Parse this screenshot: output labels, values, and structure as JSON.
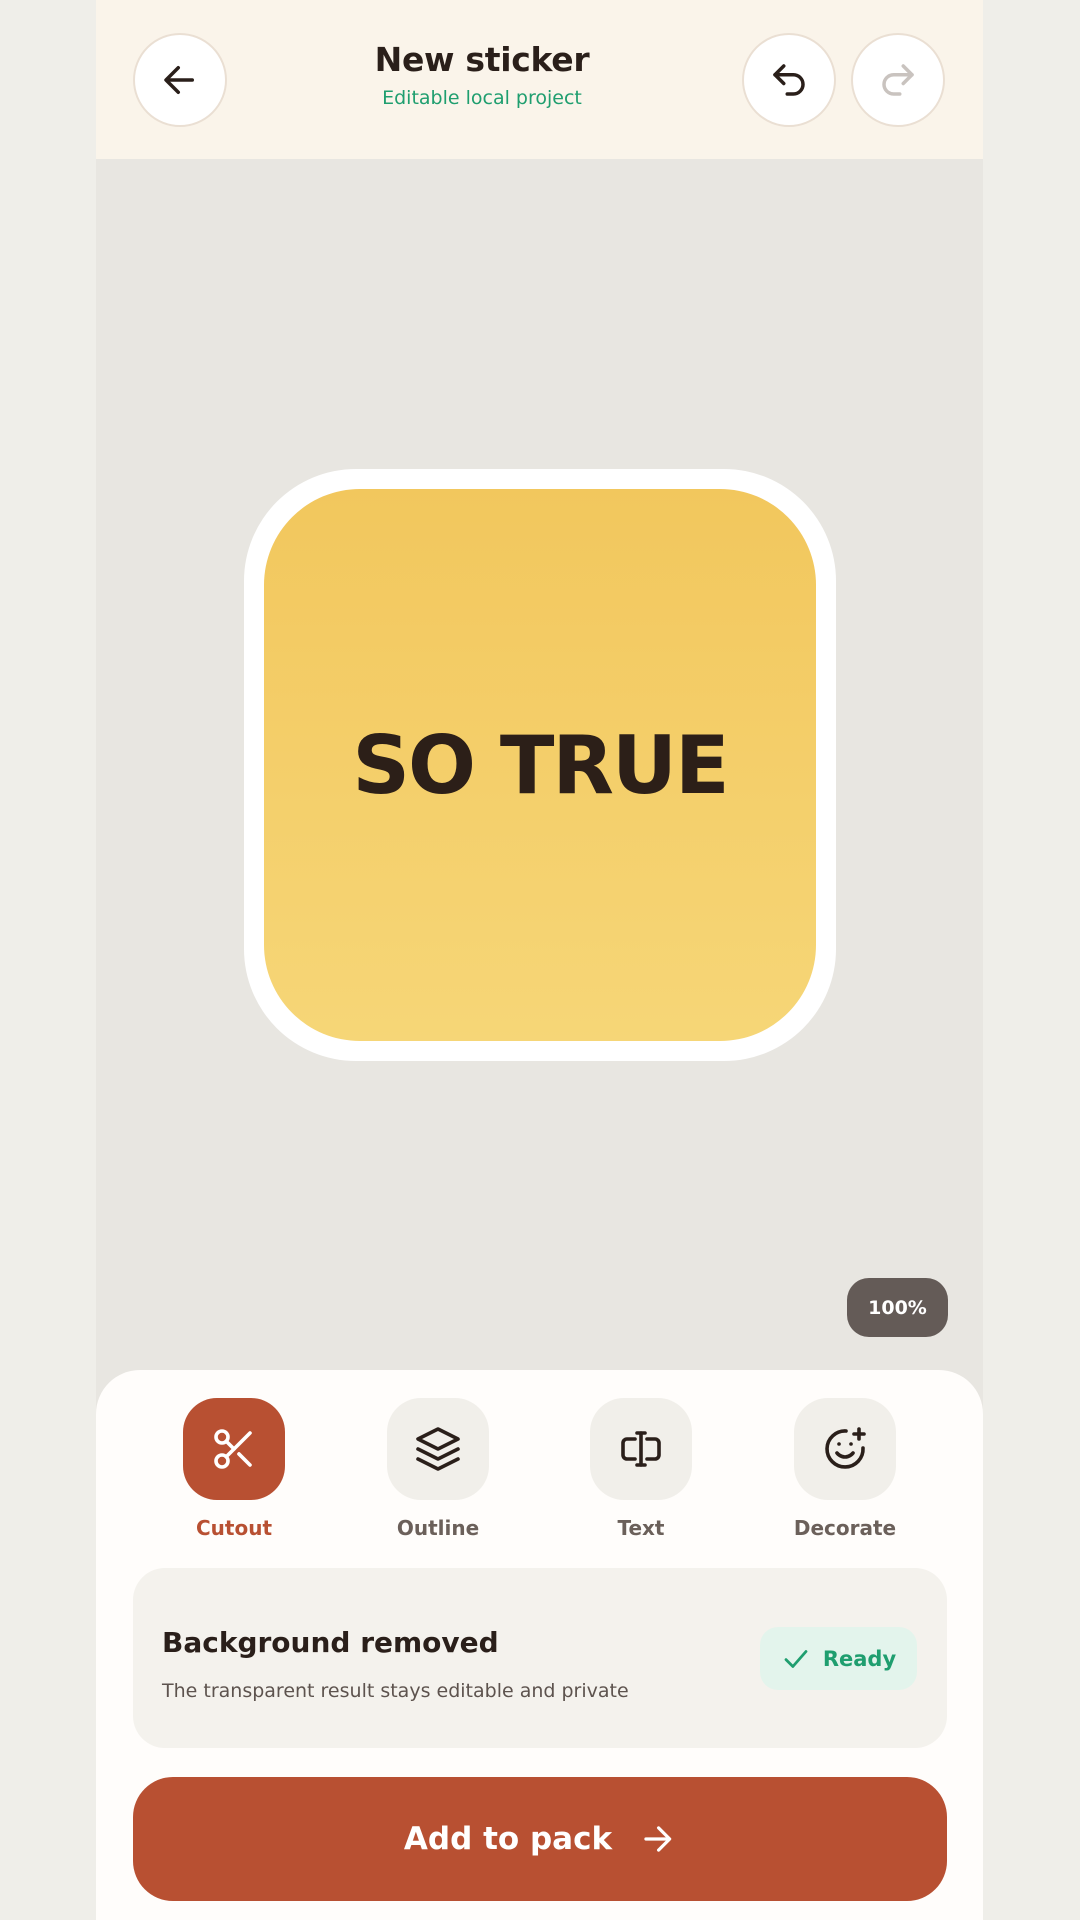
{
  "header": {
    "title": "New sticker",
    "subtitle": "Editable local project",
    "back_icon": "arrow-left-icon",
    "undo_icon": "undo-icon",
    "redo_icon": "redo-icon",
    "redo_enabled": false
  },
  "canvas": {
    "sticker_text": "SO TRUE",
    "zoom": "100%",
    "colors": {
      "background": "#e8e6e1",
      "sticker_fill_top": "#f2c75d",
      "sticker_fill_bottom": "#f6d677",
      "sticker_border": "#ffffff"
    }
  },
  "tools": [
    {
      "label": "Cutout",
      "icon": "scissors-icon",
      "active": true
    },
    {
      "label": "Outline",
      "icon": "layers-icon",
      "active": false
    },
    {
      "label": "Text",
      "icon": "text-cursor-icon",
      "active": false
    },
    {
      "label": "Decorate",
      "icon": "smiley-add-icon",
      "active": false
    }
  ],
  "status": {
    "title": "Background removed",
    "description": "The transparent result stays editable and private",
    "badge": "Ready",
    "badge_icon": "check-icon"
  },
  "cta": {
    "label": "Add to pack",
    "icon": "arrow-right-icon"
  },
  "theme": {
    "accent": "#b85032",
    "success": "#1f9e6f",
    "header_bg": "#faf4ea"
  }
}
